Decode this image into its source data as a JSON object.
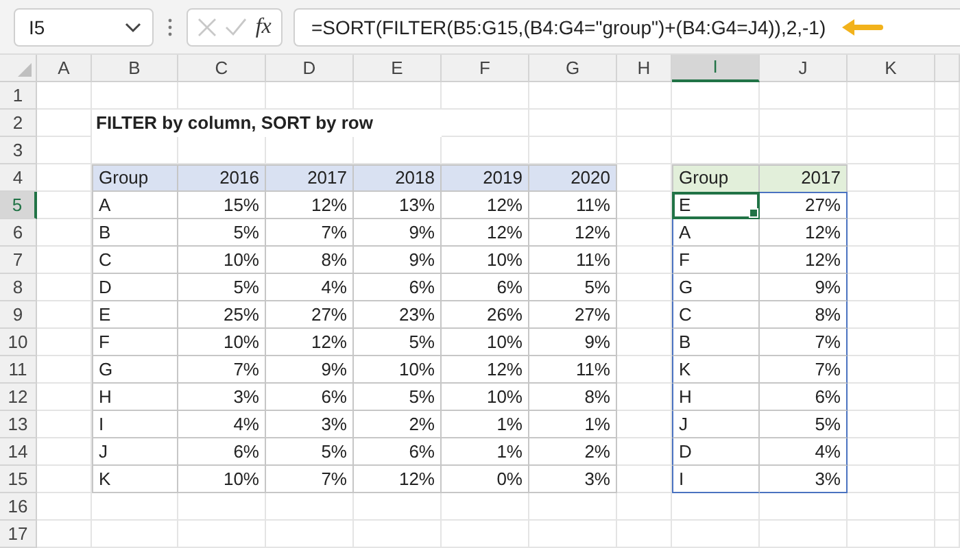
{
  "formula_bar": {
    "name_box": "I5",
    "function_label": "fx",
    "formula": "=SORT(FILTER(B5:G15,(B4:G4=\"group\")+(B4:G4=J4)),2,-1)"
  },
  "column_headers": [
    {
      "label": "A",
      "selected": false
    },
    {
      "label": "B",
      "selected": false
    },
    {
      "label": "C",
      "selected": false
    },
    {
      "label": "D",
      "selected": false
    },
    {
      "label": "E",
      "selected": false
    },
    {
      "label": "F",
      "selected": false
    },
    {
      "label": "G",
      "selected": false
    },
    {
      "label": "H",
      "selected": false
    },
    {
      "label": "I",
      "selected": true
    },
    {
      "label": "J",
      "selected": false
    },
    {
      "label": "K",
      "selected": false
    }
  ],
  "row_headers": [
    {
      "label": "1",
      "selected": false
    },
    {
      "label": "2",
      "selected": false
    },
    {
      "label": "3",
      "selected": false
    },
    {
      "label": "4",
      "selected": false
    },
    {
      "label": "5",
      "selected": true
    },
    {
      "label": "6",
      "selected": false
    },
    {
      "label": "7",
      "selected": false
    },
    {
      "label": "8",
      "selected": false
    },
    {
      "label": "9",
      "selected": false
    },
    {
      "label": "10",
      "selected": false
    },
    {
      "label": "11",
      "selected": false
    },
    {
      "label": "12",
      "selected": false
    },
    {
      "label": "13",
      "selected": false
    },
    {
      "label": "14",
      "selected": false
    },
    {
      "label": "15",
      "selected": false
    },
    {
      "label": "16",
      "selected": false
    },
    {
      "label": "17",
      "selected": false
    }
  ],
  "title": "FILTER by column, SORT by row",
  "source_table": {
    "columns": [
      "Group",
      "2016",
      "2017",
      "2018",
      "2019",
      "2020"
    ],
    "rows": [
      [
        "A",
        "15%",
        "12%",
        "13%",
        "12%",
        "11%"
      ],
      [
        "B",
        "5%",
        "7%",
        "9%",
        "12%",
        "12%"
      ],
      [
        "C",
        "10%",
        "8%",
        "9%",
        "10%",
        "11%"
      ],
      [
        "D",
        "5%",
        "4%",
        "6%",
        "6%",
        "5%"
      ],
      [
        "E",
        "25%",
        "27%",
        "23%",
        "26%",
        "27%"
      ],
      [
        "F",
        "10%",
        "12%",
        "5%",
        "10%",
        "9%"
      ],
      [
        "G",
        "7%",
        "9%",
        "10%",
        "12%",
        "11%"
      ],
      [
        "H",
        "3%",
        "6%",
        "5%",
        "10%",
        "8%"
      ],
      [
        "I",
        "4%",
        "3%",
        "2%",
        "1%",
        "1%"
      ],
      [
        "J",
        "6%",
        "5%",
        "6%",
        "1%",
        "2%"
      ],
      [
        "K",
        "10%",
        "7%",
        "12%",
        "0%",
        "3%"
      ]
    ]
  },
  "result_table": {
    "columns": [
      "Group",
      "2017"
    ],
    "rows": [
      {
        "cells": [
          "E",
          "27%"
        ],
        "active": true
      },
      {
        "cells": [
          "A",
          "12%"
        ],
        "active": false
      },
      {
        "cells": [
          "F",
          "12%"
        ],
        "active": false
      },
      {
        "cells": [
          "G",
          "9%"
        ],
        "active": false
      },
      {
        "cells": [
          "C",
          "8%"
        ],
        "active": false
      },
      {
        "cells": [
          "B",
          "7%"
        ],
        "active": false
      },
      {
        "cells": [
          "K",
          "7%"
        ],
        "active": false
      },
      {
        "cells": [
          "H",
          "6%"
        ],
        "active": false
      },
      {
        "cells": [
          "J",
          "5%"
        ],
        "active": false
      },
      {
        "cells": [
          "D",
          "4%"
        ],
        "active": false
      },
      {
        "cells": [
          "I",
          "3%"
        ],
        "active": false
      }
    ]
  }
}
